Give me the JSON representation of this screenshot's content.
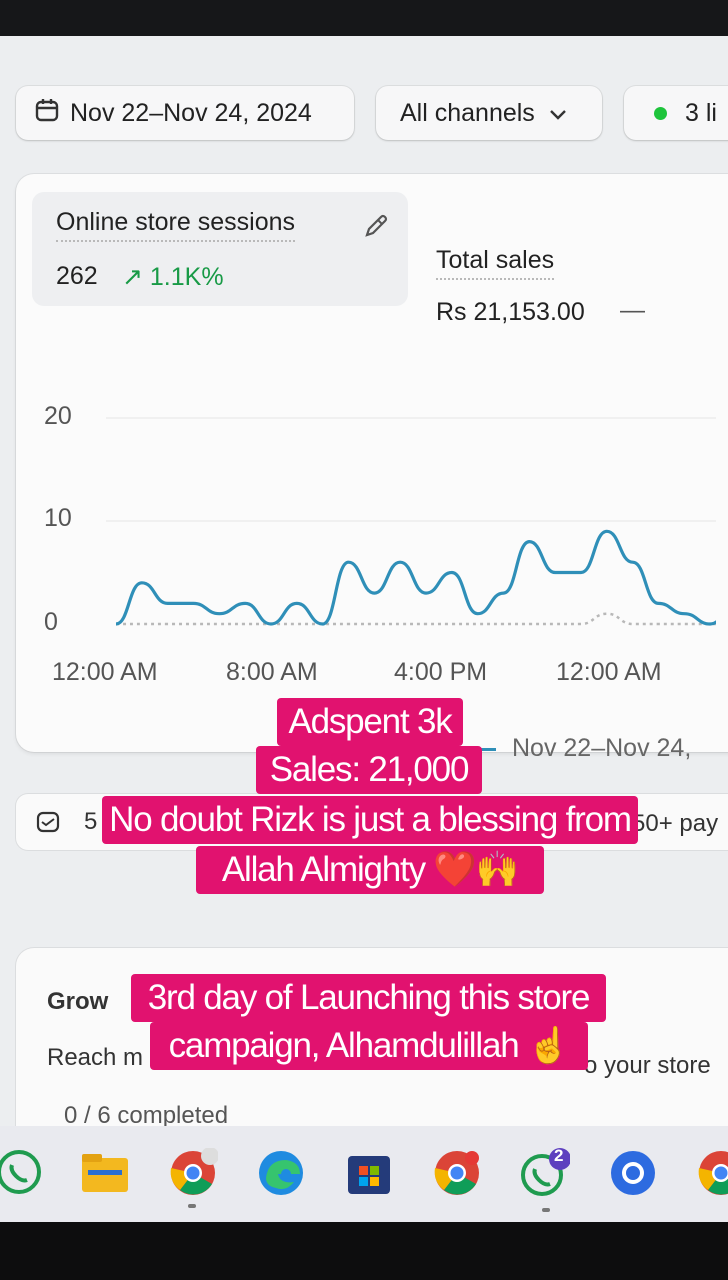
{
  "filters": {
    "date_range": "Nov 22–Nov 24, 2024",
    "channels": "All channels",
    "live_visitors": "3 li"
  },
  "metrics": {
    "sessions": {
      "title": "Online store sessions",
      "value": "262",
      "change": "↗ 1.1K%"
    },
    "total_sales": {
      "title": "Total sales",
      "value": "Rs 21,153.00",
      "change": "—"
    }
  },
  "chart_data": {
    "type": "line",
    "title": "",
    "xlabel": "",
    "ylabel": "",
    "ylim": [
      0,
      20
    ],
    "y_ticks": [
      "20",
      "10",
      "0"
    ],
    "x_ticks": [
      "12:00 AM",
      "8:00 AM",
      "4:00 PM",
      "12:00 AM"
    ],
    "legend": "Nov 22–Nov 24,",
    "series": [
      {
        "name": "Nov 22–Nov 24,",
        "color": "#2f8fb8",
        "values": [
          0,
          4,
          2,
          2,
          1,
          2,
          0,
          2,
          0,
          6,
          3,
          6,
          3,
          5,
          1,
          3,
          8,
          5,
          5,
          9,
          6,
          2,
          1,
          0,
          2
        ]
      },
      {
        "name": "",
        "color": "#b8b8b8",
        "style": "dotted",
        "values": [
          0,
          0,
          0,
          0,
          0,
          0,
          0,
          0,
          0,
          0,
          0,
          0,
          0,
          0,
          0,
          0,
          0,
          0,
          0,
          1,
          0,
          0,
          0,
          0,
          0
        ]
      }
    ]
  },
  "banner": {
    "count": "5",
    "right_text": "50+ pay"
  },
  "setup_guide": {
    "title": "Grow",
    "subtitle": "Reach m",
    "subtitle_right": "o your store",
    "progress": "0 / 6 completed"
  },
  "captions": {
    "line1": "Adspent 3k",
    "line2": "Sales: 21,000",
    "line3": "No doubt Rizk is just a blessing from",
    "line4": "Allah Almighty ❤️🙌",
    "line5": "3rd day of Launching this store",
    "line6": "campaign, Alhamdulillah ☝️"
  },
  "taskbar": {
    "icons": [
      "whatsapp-icon",
      "file-explorer-icon",
      "chrome-icon",
      "edge-icon",
      "microsoft-store-icon",
      "chrome-icon",
      "whatsapp-icon",
      "chrome-icon",
      "chrome-icon"
    ],
    "whatsapp_badge": "2"
  }
}
